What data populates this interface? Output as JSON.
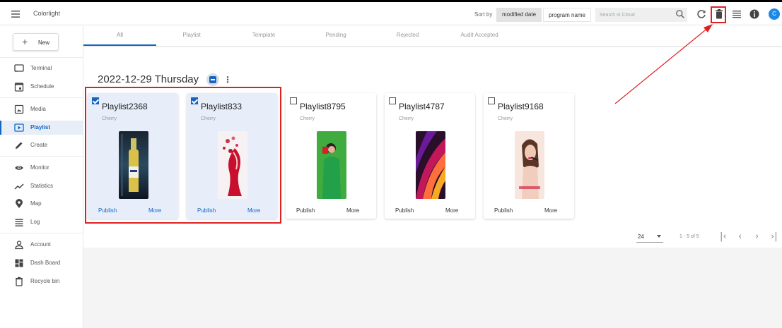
{
  "app": {
    "title": "Colorlight"
  },
  "header": {
    "sort_label": "Sort by",
    "sort_options": [
      "modified date",
      "program name"
    ],
    "search_placeholder": "Search in Cloud",
    "avatar_initial": "C"
  },
  "sidebar": {
    "new_label": "New",
    "items": [
      {
        "label": "Terminal",
        "icon": "terminal-icon"
      },
      {
        "label": "Schedule",
        "icon": "schedule-icon"
      },
      {
        "label": "Media",
        "icon": "media-icon"
      },
      {
        "label": "Playlist",
        "icon": "playlist-icon",
        "active": true
      },
      {
        "label": "Create",
        "icon": "create-icon"
      },
      {
        "label": "Monitor",
        "icon": "monitor-icon"
      },
      {
        "label": "Statistics",
        "icon": "statistics-icon"
      },
      {
        "label": "Map",
        "icon": "map-icon"
      },
      {
        "label": "Log",
        "icon": "log-icon"
      },
      {
        "label": "Account",
        "icon": "account-icon"
      },
      {
        "label": "Dash Board",
        "icon": "dashboard-icon"
      },
      {
        "label": "Recycle bin",
        "icon": "recycle-bin-icon"
      }
    ]
  },
  "tabs": [
    "All",
    "Playlist",
    "Template",
    "Pending",
    "Rejected",
    "Audit Accepted"
  ],
  "group": {
    "date": "2022-12-29 Thursday"
  },
  "cards": [
    {
      "title": "Playlist2368",
      "owner": "Cherry",
      "selected": true,
      "publish": "Publish",
      "more": "More"
    },
    {
      "title": "Playlist833",
      "owner": "Cherry",
      "selected": true,
      "publish": "Publish",
      "more": "More"
    },
    {
      "title": "Playlist8795",
      "owner": "Cherry",
      "selected": false,
      "publish": "Publish",
      "more": "More"
    },
    {
      "title": "Playlist4787",
      "owner": "Cherry",
      "selected": false,
      "publish": "Publish",
      "more": "More"
    },
    {
      "title": "Playlist9168",
      "owner": "Cherry",
      "selected": false,
      "publish": "Publish",
      "more": "More"
    }
  ],
  "pager": {
    "page_size": "24",
    "range": "1 - 5 of 5"
  },
  "colors": {
    "accent": "#1565c0",
    "highlight": "#e02020",
    "avatar": "#1e88e5"
  }
}
